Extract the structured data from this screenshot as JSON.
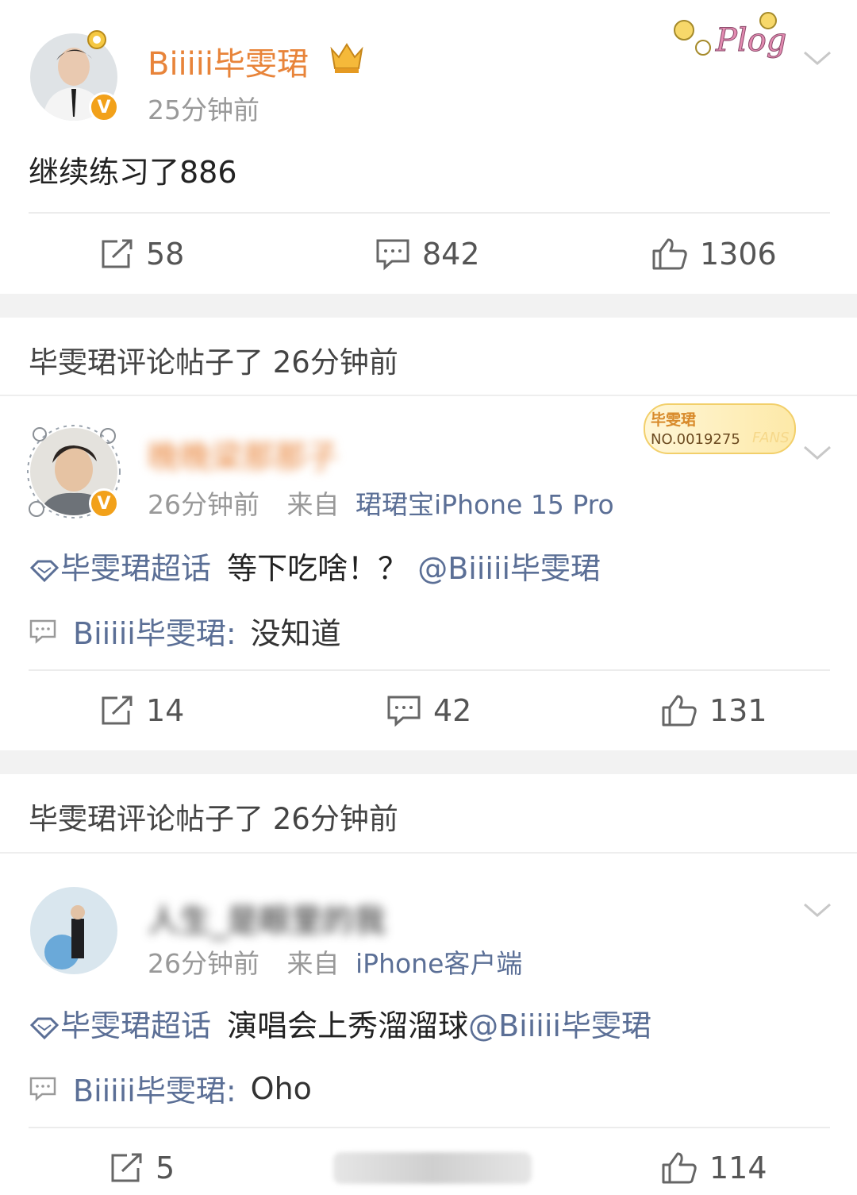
{
  "posts": [
    {
      "name": "Biiiii毕雯珺",
      "time": "25分钟前",
      "content": "继续练习了886",
      "sticker": "Plog",
      "repost": "58",
      "comment": "842",
      "like": "1306"
    },
    {
      "section": "毕雯珺评论帖子了 26分钟前",
      "name": "晚晚梁那那子",
      "time": "26分钟前",
      "from_prefix": "来自",
      "from": "珺珺宝iPhone 15 Pro",
      "badge": {
        "title": "毕雯珺",
        "number": "NO.0019275",
        "fans": "FANS"
      },
      "topic": "毕雯珺超话",
      "text": " 等下吃啥！？",
      "mention": "@Biiiii毕雯珺",
      "reply_name": "Biiiii毕雯珺:",
      "reply_text": "没知道",
      "repost": "14",
      "comment": "42",
      "like": "131"
    },
    {
      "section": "毕雯珺评论帖子了 26分钟前",
      "name": "人生_是眼里的我",
      "time": "26分钟前",
      "from_prefix": "来自",
      "from": "iPhone客户端",
      "topic": "毕雯珺超话",
      "text": " 演唱会上秀溜溜球",
      "mention": "@Biiiii毕雯珺",
      "reply_name": "Biiiii毕雯珺:",
      "reply_text": "Oho",
      "repost": "5",
      "like": "114"
    }
  ],
  "colors": {
    "name_orange": "#e8843a",
    "link_blue": "#5b6f96",
    "gap": "#f2f2f2",
    "verify": "#f2a11a"
  },
  "icons": [
    "repost-icon",
    "comment-icon",
    "like-icon",
    "chevron-down-icon",
    "topic-diamond-icon",
    "reply-comment-icon",
    "verify-badge-icon",
    "crown-badge-icon"
  ]
}
